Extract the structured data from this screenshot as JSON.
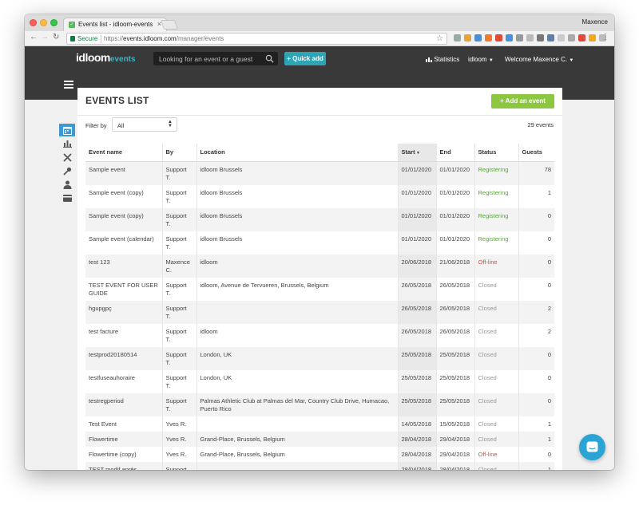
{
  "browser": {
    "tab_title": "Events list - idloom-events",
    "user": "Maxence",
    "secure_label": "Secure",
    "url_scheme": "https://",
    "url_host": "events.idloom.com",
    "url_path": "/manager/events"
  },
  "header": {
    "logo_main": "idloom",
    "logo_sub": "events",
    "search_placeholder": "Looking for an event or a guest",
    "quick_add": "+ Quick add",
    "statistics": "Statistics",
    "org_menu": "idloom",
    "welcome": "Welcome Maxence C."
  },
  "page": {
    "title": "EVENTS LIST",
    "add_event": "+ Add an event",
    "filter_label": "Filter by",
    "filter_value": "All",
    "events_count": "29 events"
  },
  "table": {
    "columns": {
      "name": "Event name",
      "by": "By",
      "location": "Location",
      "start": "Start",
      "end": "End",
      "status": "Status",
      "guests": "Guests"
    },
    "rows": [
      {
        "name": "Sample event",
        "by": "Support T.",
        "location": "idloom Brussels",
        "start": "01/01/2020",
        "end": "01/01/2020",
        "status": "Registering",
        "guests": "78"
      },
      {
        "name": "Sample event (copy)",
        "by": "Support T.",
        "location": "idloom Brussels",
        "start": "01/01/2020",
        "end": "01/01/2020",
        "status": "Registering",
        "guests": "1"
      },
      {
        "name": "Sample event (copy)",
        "by": "Support T.",
        "location": "idloom Brussels",
        "start": "01/01/2020",
        "end": "01/01/2020",
        "status": "Registering",
        "guests": "0"
      },
      {
        "name": "Sample event (calendar)",
        "by": "Support T.",
        "location": "idloom Brussels",
        "start": "01/01/2020",
        "end": "01/01/2020",
        "status": "Registering",
        "guests": "0"
      },
      {
        "name": "test 123",
        "by": "Maxence C.",
        "location": "idloom",
        "start": "20/06/2018",
        "end": "21/06/2018",
        "status": "Off-line",
        "guests": "0"
      },
      {
        "name": "TEST EVENT FOR USER GUIDE",
        "by": "Support T.",
        "location": "idloom, Avenue de Tervueren, Brussels, Belgium",
        "start": "26/05/2018",
        "end": "26/05/2018",
        "status": "Closed",
        "guests": "0"
      },
      {
        "name": "hgupgpç",
        "by": "Support T.",
        "location": "",
        "start": "26/05/2018",
        "end": "26/05/2018",
        "status": "Closed",
        "guests": "2"
      },
      {
        "name": "test facture",
        "by": "Support T.",
        "location": "idloom",
        "start": "26/05/2018",
        "end": "26/05/2018",
        "status": "Closed",
        "guests": "2"
      },
      {
        "name": "testprod20180514",
        "by": "Support T.",
        "location": "London, UK",
        "start": "25/05/2018",
        "end": "25/05/2018",
        "status": "Closed",
        "guests": "0"
      },
      {
        "name": "testfuseauhoraire",
        "by": "Support T.",
        "location": "London, UK",
        "start": "25/05/2018",
        "end": "25/05/2018",
        "status": "Closed",
        "guests": "0"
      },
      {
        "name": "testregperiod",
        "by": "Support T.",
        "location": "Palmas Athletic Club at Palmas del Mar, Country Club Drive, Humacao, Puerto Rico",
        "start": "25/05/2018",
        "end": "25/05/2018",
        "status": "Closed",
        "guests": "0"
      },
      {
        "name": "Test Event",
        "by": "Yves R.",
        "location": "",
        "start": "14/05/2018",
        "end": "15/05/2018",
        "status": "Closed",
        "guests": "1"
      },
      {
        "name": "Flowertime",
        "by": "Yves R.",
        "location": "Grand-Place, Brussels, Belgium",
        "start": "28/04/2018",
        "end": "29/04/2018",
        "status": "Closed",
        "guests": "1"
      },
      {
        "name": "Flowertime (copy)",
        "by": "Yves R.",
        "location": "Grand-Place, Brussels, Belgium",
        "start": "28/04/2018",
        "end": "29/04/2018",
        "status": "Off-line",
        "guests": "0"
      },
      {
        "name": "TEST modif après",
        "by": "Support T.",
        "location": "",
        "start": "28/04/2018",
        "end": "28/04/2018",
        "status": "Closed",
        "guests": "1"
      }
    ]
  },
  "colors": {
    "header_bg": "#393939",
    "accent_teal": "#2fa4b4",
    "add_green": "#8dc63f",
    "registering": "#5aa83a",
    "offline": "#e0493f",
    "closed": "#999999"
  },
  "icons": {
    "sidebar": [
      "calendar-icon",
      "bar-chart-icon",
      "tools-icon",
      "key-icon",
      "user-icon",
      "card-icon"
    ]
  }
}
